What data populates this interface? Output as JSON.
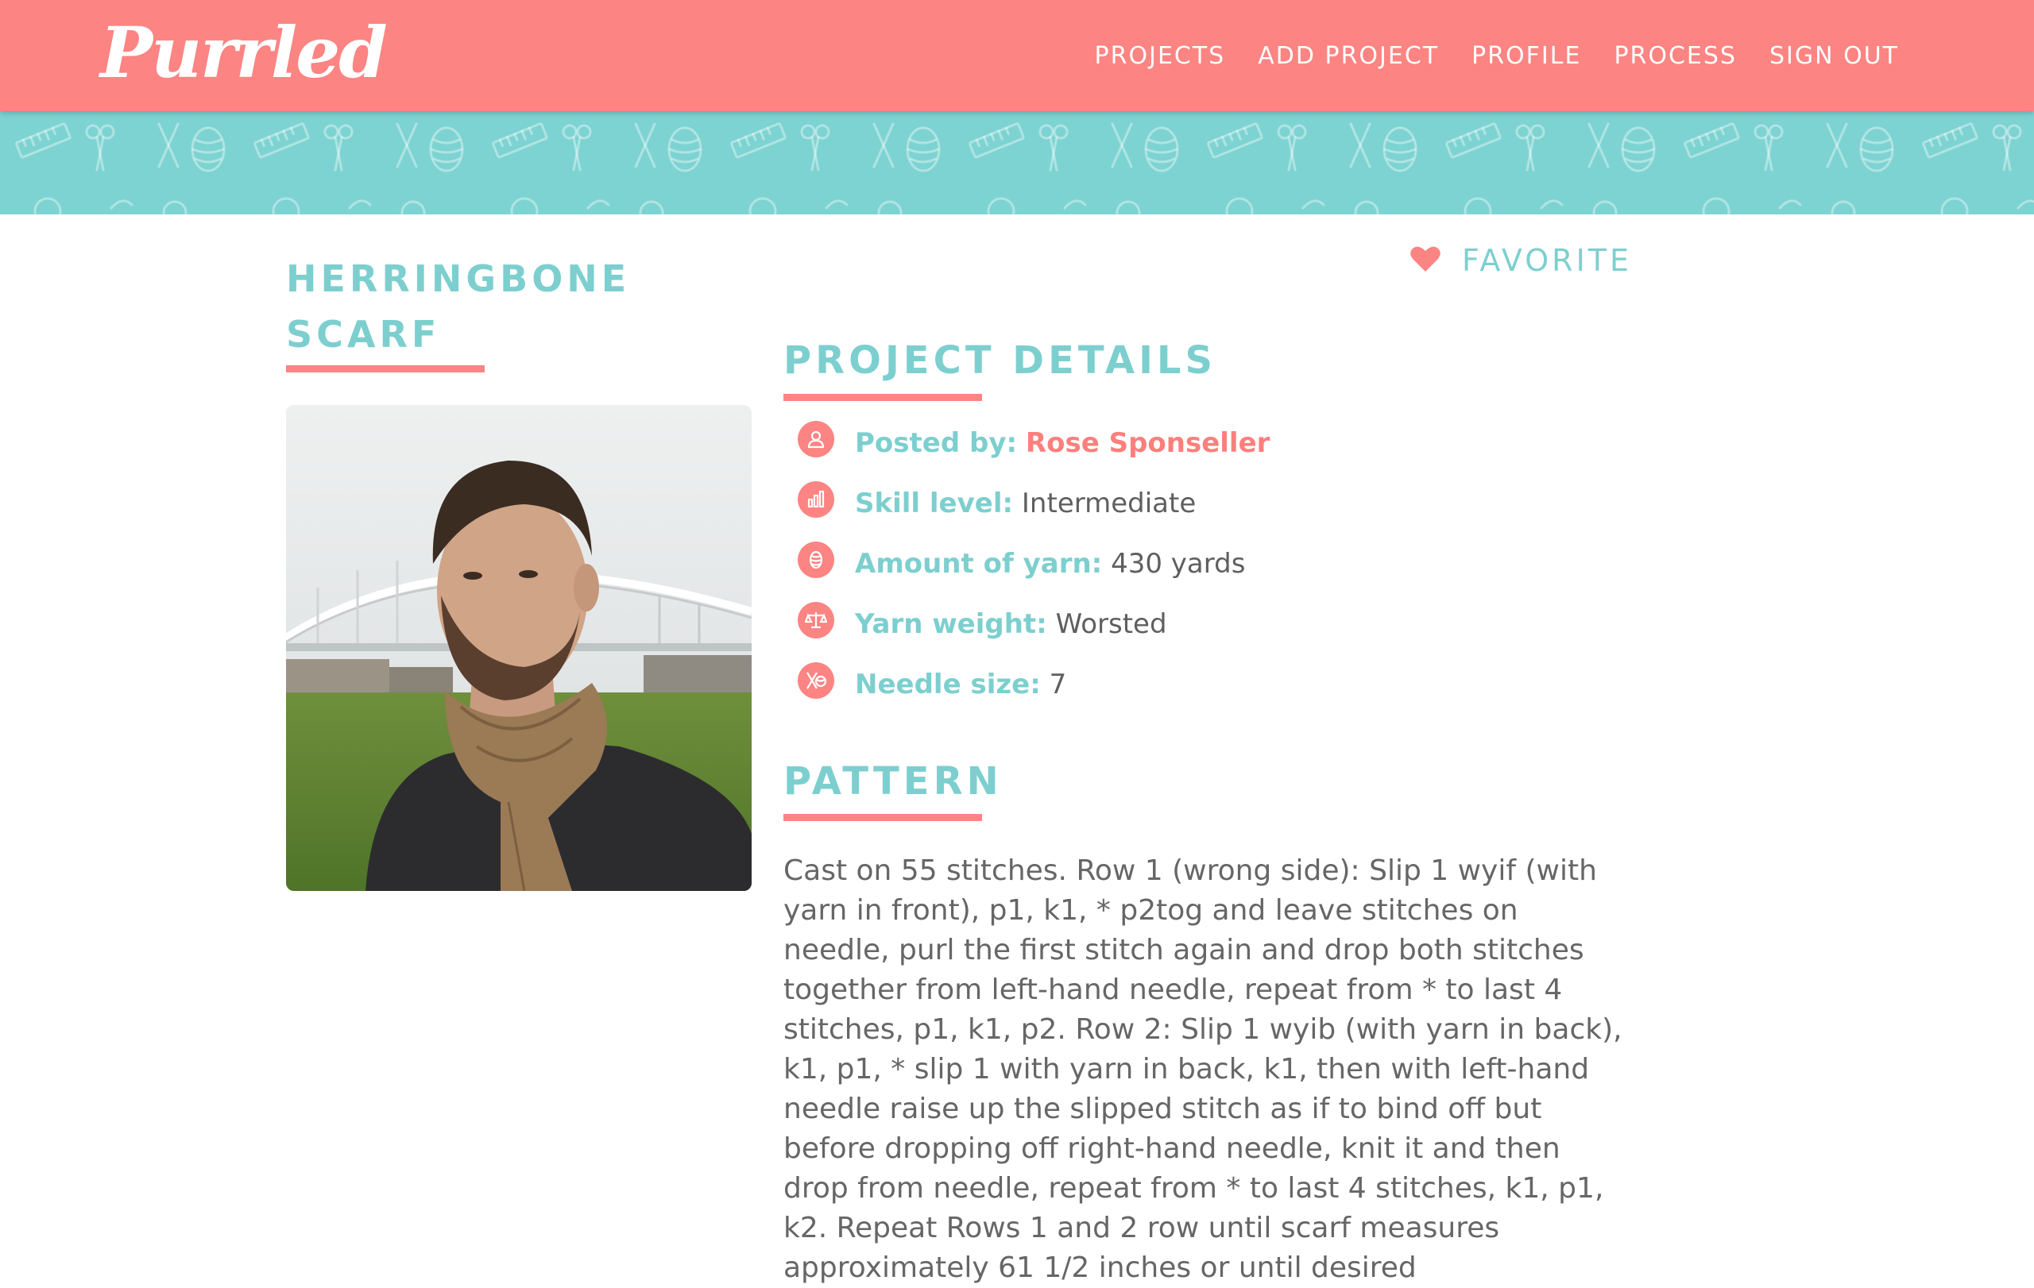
{
  "nav": {
    "logo": "Purrled",
    "links": [
      "PROJECTS",
      "ADD PROJECT",
      "PROFILE",
      "PROCESS",
      "SIGN OUT"
    ]
  },
  "project": {
    "title": "HERRINGBONE SCARF",
    "favorite_label": "FAVORITE",
    "details_heading": "PROJECT DETAILS",
    "details": {
      "posted_by_label": "Posted by:",
      "posted_by_value": "Rose Sponseller",
      "skill_label": "Skill level:",
      "skill_value": "Intermediate",
      "yarn_amount_label": "Amount of yarn:",
      "yarn_amount_value": "430 yards",
      "yarn_weight_label": "Yarn weight:",
      "yarn_weight_value": "Worsted",
      "needle_label": "Needle size:",
      "needle_value": "7"
    },
    "pattern_heading": "PATTERN",
    "pattern_text": "Cast on 55 stitches. Row 1 (wrong side): Slip 1 wyif (with yarn in front), p1, k1, * p2tog and leave stitches on needle, purl the first stitch again and drop both stitches together from left-hand needle, repeat from * to last 4 stitches, p1, k1, p2. Row 2: Slip 1 wyib (with yarn in back), k1, p1, * slip 1 with yarn in back, k1, then with left-hand needle raise up the slipped stitch as if to bind off but before dropping off right-hand needle, knit it and then drop from needle, repeat from * to last 4 stitches, k1, p1, k2. Repeat Rows 1 and 2 row until scarf measures approximately 61 1/2 inches or until desired"
  },
  "colors": {
    "nav_bg": "#fc8482",
    "accent_teal": "#7dcfcf",
    "band_teal": "#7dd3d2",
    "text_gray": "#666666"
  },
  "icons": {
    "favorite": "heart-icon",
    "posted_by": "user-icon",
    "skill": "bar-chart-icon",
    "yarn_amount": "yarn-ball-icon",
    "yarn_weight": "scale-icon",
    "needle": "needle-yarn-icon"
  }
}
